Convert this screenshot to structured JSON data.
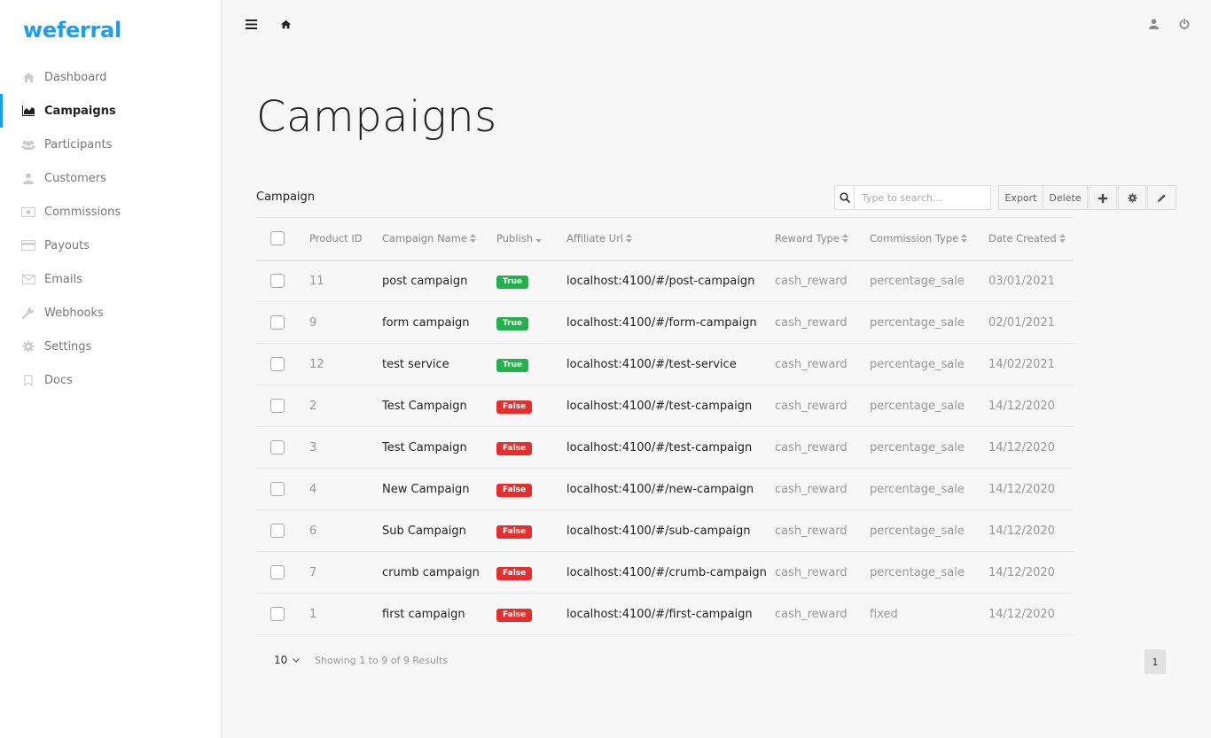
{
  "app": {
    "logo": "weferral"
  },
  "sidebar": {
    "items": [
      {
        "label": "Dashboard",
        "icon": "home-icon",
        "active": false
      },
      {
        "label": "Campaigns",
        "icon": "area-chart-icon",
        "active": true
      },
      {
        "label": "Participants",
        "icon": "users-icon",
        "active": false
      },
      {
        "label": "Customers",
        "icon": "user-icon",
        "active": false
      },
      {
        "label": "Commissions",
        "icon": "money-icon",
        "active": false
      },
      {
        "label": "Payouts",
        "icon": "credit-card-icon",
        "active": false
      },
      {
        "label": "Emails",
        "icon": "envelope-icon",
        "active": false
      },
      {
        "label": "Webhooks",
        "icon": "wrench-icon",
        "active": false
      },
      {
        "label": "Settings",
        "icon": "gear-icon",
        "active": false
      },
      {
        "label": "Docs",
        "icon": "bookmark-icon",
        "active": false
      }
    ]
  },
  "page": {
    "title": "Campaigns"
  },
  "toolbar": {
    "section_label": "Campaign",
    "search_placeholder": "Type to search...",
    "export_label": "Export",
    "delete_label": "Delete"
  },
  "table": {
    "headers": {
      "product_id": "Product ID",
      "campaign_name": "Campaign Name",
      "publish": "Publish",
      "affiliate_url": "Affiliate Url",
      "reward_type": "Reward Type",
      "commission_type": "Commission Type",
      "date_created": "Date Created"
    },
    "rows": [
      {
        "id": "11",
        "name": "post campaign",
        "publish": "True",
        "url": "localhost:4100/#/post-campaign",
        "reward": "cash_reward",
        "commission": "percentage_sale",
        "date": "03/01/2021"
      },
      {
        "id": "9",
        "name": "form campaign",
        "publish": "True",
        "url": "localhost:4100/#/form-campaign",
        "reward": "cash_reward",
        "commission": "percentage_sale",
        "date": "02/01/2021"
      },
      {
        "id": "12",
        "name": "test service",
        "publish": "True",
        "url": "localhost:4100/#/test-service",
        "reward": "cash_reward",
        "commission": "percentage_sale",
        "date": "14/02/2021"
      },
      {
        "id": "2",
        "name": "Test Campaign",
        "publish": "False",
        "url": "localhost:4100/#/test-campaign",
        "reward": "cash_reward",
        "commission": "percentage_sale",
        "date": "14/12/2020"
      },
      {
        "id": "3",
        "name": "Test Campaign",
        "publish": "False",
        "url": "localhost:4100/#/test-campaign",
        "reward": "cash_reward",
        "commission": "percentage_sale",
        "date": "14/12/2020"
      },
      {
        "id": "4",
        "name": "New Campaign",
        "publish": "False",
        "url": "localhost:4100/#/new-campaign",
        "reward": "cash_reward",
        "commission": "percentage_sale",
        "date": "14/12/2020"
      },
      {
        "id": "6",
        "name": "Sub Campaign",
        "publish": "False",
        "url": "localhost:4100/#/sub-campaign",
        "reward": "cash_reward",
        "commission": "percentage_sale",
        "date": "14/12/2020"
      },
      {
        "id": "7",
        "name": "crumb campaign",
        "publish": "False",
        "url": "localhost:4100/#/crumb-campaign",
        "reward": "cash_reward",
        "commission": "percentage_sale",
        "date": "14/12/2020"
      },
      {
        "id": "1",
        "name": "first campaign",
        "publish": "False",
        "url": "localhost:4100/#/first-campaign",
        "reward": "cash_reward",
        "commission": "fixed",
        "date": "14/12/2020"
      }
    ]
  },
  "footer": {
    "page_size": "10",
    "info": "Showing 1 to 9 of 9 Results",
    "current_page": "1"
  },
  "colors": {
    "accent": "#1a9ff0",
    "true_badge": "#22b14c",
    "false_badge": "#e62e2e"
  }
}
